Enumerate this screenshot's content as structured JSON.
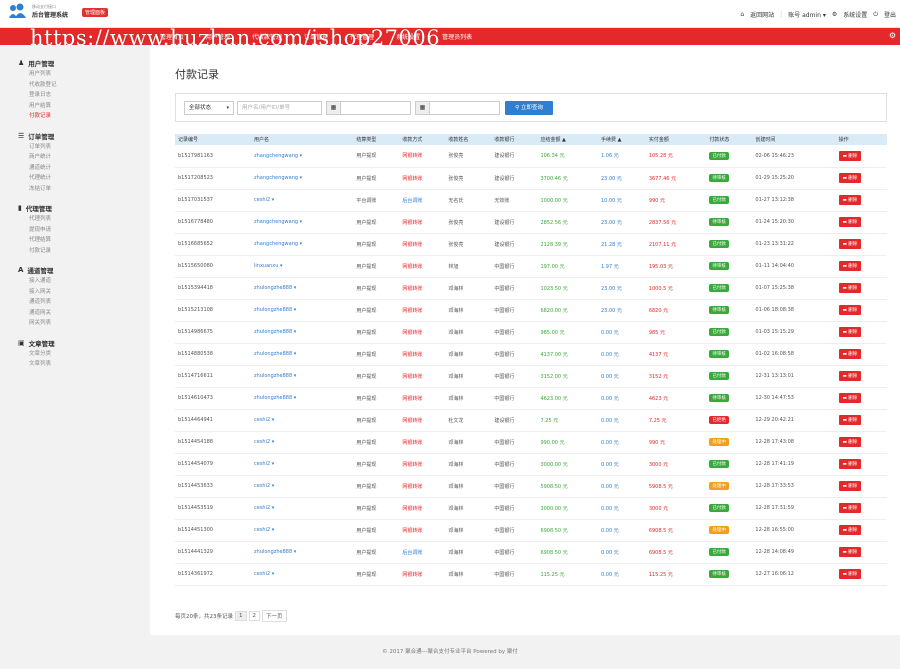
{
  "header": {
    "logo_sub": "移动支付接口",
    "logo_title": "后台管理系统",
    "badge": "管理面板",
    "links": [
      {
        "icon": "home-icon",
        "label": "返回网站"
      },
      {
        "label": "账号 admin"
      },
      {
        "icon": "gear-icon",
        "label": "系统设置"
      },
      {
        "icon": "power-icon",
        "label": "登出"
      }
    ]
  },
  "navbar": {
    "items": [
      "管理首页",
      "用户管理",
      "代收款管理",
      "订单管理",
      "代理管理",
      "系统设置",
      "管理员列表"
    ]
  },
  "watermark": "https://www.huzhan.com/ishop27006",
  "sidebar": {
    "groups": [
      {
        "icon": "user-icon",
        "title": "用户管理",
        "items": [
          "用户列表",
          "代收款登记",
          "登录日志",
          "用户结算",
          "付款记录"
        ]
      },
      {
        "icon": "list-icon",
        "title": "订单管理",
        "items": [
          "订单列表",
          "商户统计",
          "通道统计",
          "代理统计",
          "冻结订单"
        ]
      },
      {
        "icon": "bookmark-icon",
        "title": "代理管理",
        "items": [
          "代理列表",
          "提现申请",
          "代理结算",
          "付款记录"
        ]
      },
      {
        "icon": "font-icon",
        "title": "通道管理",
        "items": [
          "接入通道",
          "接入网关",
          "通道列表",
          "通道网关",
          "网关列表"
        ]
      },
      {
        "icon": "doc-icon",
        "title": "文章管理",
        "items": [
          "文章分类",
          "文章列表"
        ]
      }
    ]
  },
  "main": {
    "title": "付款记录",
    "filter": {
      "status_value": "全部状态",
      "user_placeholder": "用户名/用户ID/单号",
      "search_label": "立即查询"
    },
    "table": {
      "headers": [
        "记录编号",
        "用户名",
        "结算类型",
        "收款方式",
        "收款姓名",
        "收款银行",
        "应结金额 ▲",
        "手续费 ▲",
        "实付金额",
        "付款状态",
        "创建时间",
        "操作"
      ],
      "rows": [
        {
          "id": "b1517981163",
          "user": "zhangchengwang",
          "type": "用户提现",
          "method": "网银转账",
          "name": "张俊亮",
          "bank": "建设银行",
          "amount": "106.34 元",
          "fee": "1.06 元",
          "paid": "105.28 元",
          "status": "已付款",
          "time": "02-06 15:46:23",
          "op": "删除"
        },
        {
          "id": "b1517208523",
          "user": "zhangchengwang",
          "type": "用户提现",
          "method": "网银转账",
          "name": "张俊亮",
          "bank": "建设银行",
          "amount": "3700.46 元",
          "fee": "23.00 元",
          "paid": "3677.46 元",
          "status": "待审核",
          "time": "01-29 15:25:20",
          "op": "删除"
        },
        {
          "id": "b1517031537",
          "user": "ceshi2",
          "type": "平台调账",
          "method": "后台调账",
          "name": "无名氏",
          "bank": "无效账",
          "amount": "1000.00 元",
          "fee": "10.00 元",
          "paid": "990 元",
          "status": "已付款",
          "time": "01-27 13:12:38",
          "op": "删除"
        },
        {
          "id": "b1516778480",
          "user": "zhangchengwang",
          "type": "用户提现",
          "method": "网银转账",
          "name": "张俊亮",
          "bank": "建设银行",
          "amount": "2852.56 元",
          "fee": "23.00 元",
          "paid": "2837.56 元",
          "status": "待审核",
          "time": "01-24 15:20:30",
          "op": "删除"
        },
        {
          "id": "b1516685652",
          "user": "zhangchengwang",
          "type": "用户提现",
          "method": "网银转账",
          "name": "张俊亮",
          "bank": "建设银行",
          "amount": "2128.39 元",
          "fee": "21.28 元",
          "paid": "2107.11 元",
          "status": "已付款",
          "time": "01-23 13:31:22",
          "op": "删除"
        },
        {
          "id": "b1515650080",
          "user": "linxuanxu",
          "type": "用户提现",
          "method": "网银转账",
          "name": "林旭",
          "bank": "中国银行",
          "amount": "197.00 元",
          "fee": "1.97 元",
          "paid": "195.03 元",
          "status": "待审核",
          "time": "01-11 14:04:40",
          "op": "删除"
        },
        {
          "id": "b1515394418",
          "user": "zhulongzhe888",
          "type": "用户提现",
          "method": "网银转账",
          "name": "邓海林",
          "bank": "中国银行",
          "amount": "1023.50 元",
          "fee": "23.00 元",
          "paid": "1000.5 元",
          "status": "已付款",
          "time": "01-07 15:25:38",
          "op": "删除"
        },
        {
          "id": "b1515213108",
          "user": "zhulongzhe888",
          "type": "用户提现",
          "method": "网银转账",
          "name": "邓海林",
          "bank": "中国银行",
          "amount": "6820.00 元",
          "fee": "23.00 元",
          "paid": "6820 元",
          "status": "待审核",
          "time": "01-06 18:08:38",
          "op": "删除"
        },
        {
          "id": "b1514986675",
          "user": "zhulongzhe888",
          "type": "用户提现",
          "method": "网银转账",
          "name": "邓海林",
          "bank": "中国银行",
          "amount": "985.00 元",
          "fee": "0.00 元",
          "paid": "985 元",
          "status": "已付款",
          "time": "01-03 15:15:29",
          "op": "删除"
        },
        {
          "id": "b1514880538",
          "user": "zhulongzhe888",
          "type": "用户提现",
          "method": "网银转账",
          "name": "邓海林",
          "bank": "中国银行",
          "amount": "4137.00 元",
          "fee": "0.00 元",
          "paid": "4137 元",
          "status": "待审核",
          "time": "01-02 16:08:58",
          "op": "删除"
        },
        {
          "id": "b1514716611",
          "user": "zhulongzhe888",
          "type": "用户提现",
          "method": "网银转账",
          "name": "邓海林",
          "bank": "中国银行",
          "amount": "3152.00 元",
          "fee": "0.00 元",
          "paid": "3152 元",
          "status": "已付款",
          "time": "12-31 13:13:01",
          "op": "删除"
        },
        {
          "id": "b1514610473",
          "user": "zhulongzhe888",
          "type": "用户提现",
          "method": "网银转账",
          "name": "邓海林",
          "bank": "中国银行",
          "amount": "4623.00 元",
          "fee": "0.00 元",
          "paid": "4623 元",
          "status": "待审核",
          "time": "12-30 14:47:53",
          "op": "删除"
        },
        {
          "id": "b1514464941",
          "user": "ceshi2",
          "type": "用户提现",
          "method": "网银转账",
          "name": "杜文龙",
          "bank": "建设银行",
          "amount": "7.25 元",
          "fee": "0.00 元",
          "paid": "7.25 元",
          "status": "已拒绝",
          "time": "12-29 20:42:21",
          "op": "删除"
        },
        {
          "id": "b1514454188",
          "user": "ceshi2",
          "type": "用户提现",
          "method": "网银转账",
          "name": "邓海林",
          "bank": "中国银行",
          "amount": "990.00 元",
          "fee": "0.00 元",
          "paid": "990 元",
          "status": "处理中",
          "time": "12-28 17:43:08",
          "op": "删除"
        },
        {
          "id": "b1514454079",
          "user": "ceshi2",
          "type": "用户提现",
          "method": "网银转账",
          "name": "邓海林",
          "bank": "中国银行",
          "amount": "3000.00 元",
          "fee": "0.00 元",
          "paid": "3000 元",
          "status": "已付款",
          "time": "12-28 17:41:19",
          "op": "删除"
        },
        {
          "id": "b1514453633",
          "user": "ceshi2",
          "type": "用户提现",
          "method": "网银转账",
          "name": "邓海林",
          "bank": "中国银行",
          "amount": "5908.50 元",
          "fee": "0.00 元",
          "paid": "5908.5 元",
          "status": "处理中",
          "time": "12-28 17:33:53",
          "op": "删除"
        },
        {
          "id": "b1514453519",
          "user": "ceshi2",
          "type": "用户提现",
          "method": "网银转账",
          "name": "邓海林",
          "bank": "中国银行",
          "amount": "3000.00 元",
          "fee": "0.00 元",
          "paid": "3000 元",
          "status": "已付款",
          "time": "12-28 17:31:59",
          "op": "删除"
        },
        {
          "id": "b1514451300",
          "user": "ceshi2",
          "type": "用户提现",
          "method": "网银转账",
          "name": "邓海林",
          "bank": "中国银行",
          "amount": "6908.50 元",
          "fee": "0.00 元",
          "paid": "6908.5 元",
          "status": "处理中",
          "time": "12-28 16:55:00",
          "op": "删除"
        },
        {
          "id": "b1514441329",
          "user": "zhulongzhe888",
          "type": "用户提现",
          "method": "后台调账",
          "name": "邓海林",
          "bank": "中国银行",
          "amount": "6908.50 元",
          "fee": "0.00 元",
          "paid": "6908.5 元",
          "status": "已付款",
          "time": "12-28 14:08:49",
          "op": "删除"
        },
        {
          "id": "b1514361972",
          "user": "ceshi2",
          "type": "用户提现",
          "method": "网银转账",
          "name": "邓海林",
          "bank": "中国银行",
          "amount": "115.25 元",
          "fee": "0.00 元",
          "paid": "115.25 元",
          "status": "待审核",
          "time": "12-27 16:06:12",
          "op": "删除"
        }
      ]
    },
    "pagination": {
      "summary": "每页20条，共23条记录",
      "pages": [
        "1",
        "2"
      ],
      "next": "下一页"
    }
  },
  "footer": "© 2017 聚合通---聚合支付专业平台 Powered by 聚付",
  "colors": {
    "brand_red": "#e5292b",
    "link_blue": "#2f7fd0",
    "success_green": "#3aa83a",
    "warning_orange": "#f0a020"
  }
}
